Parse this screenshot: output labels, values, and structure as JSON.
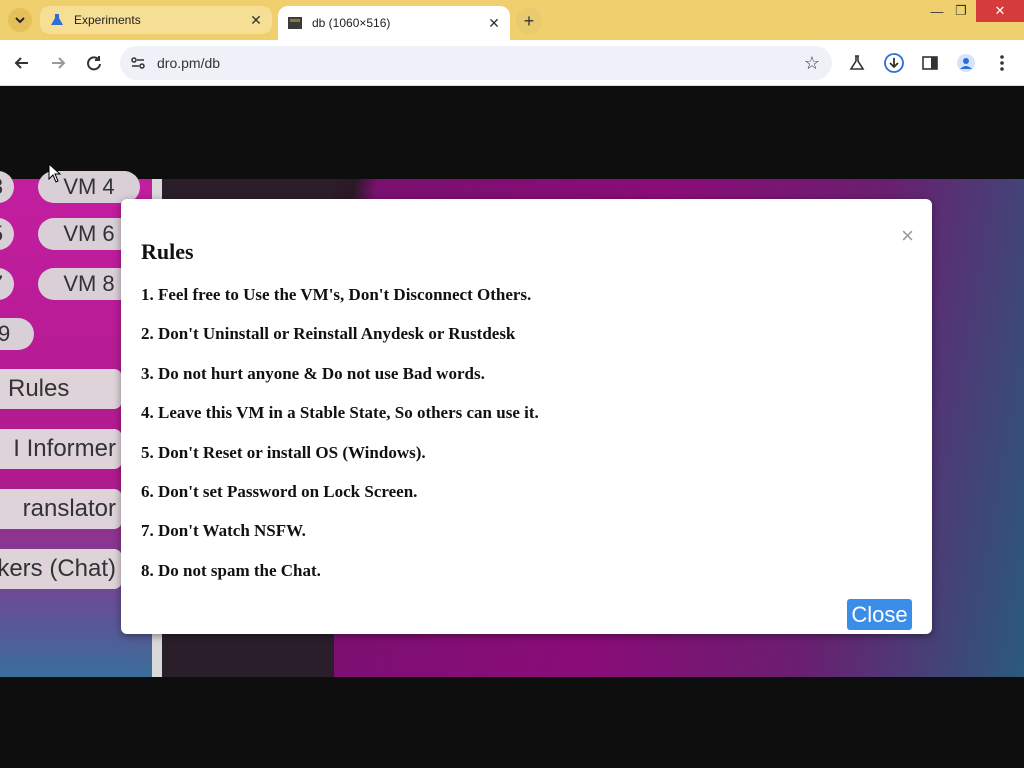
{
  "browser": {
    "tabs": [
      {
        "title": "Experiments",
        "active": false
      },
      {
        "title": "db (1060×516)",
        "active": true
      }
    ],
    "url": "dro.pm/db"
  },
  "sidebar": {
    "vm_pills": [
      {
        "label": "3"
      },
      {
        "label": "VM 4"
      },
      {
        "label": "5"
      },
      {
        "label": "VM 6"
      },
      {
        "label": "7"
      },
      {
        "label": "VM 8"
      },
      {
        "label": "9"
      }
    ],
    "buttons": [
      {
        "label": "Rules"
      },
      {
        "label": "I Informer"
      },
      {
        "label": "ranslator"
      },
      {
        "label": "kers (Chat)"
      }
    ]
  },
  "modal": {
    "title": "Rules",
    "close_x": "×",
    "rules": [
      "1. Feel free to Use the VM's, Don't Disconnect Others.",
      "2. Don't Uninstall or Reinstall Anydesk or Rustdesk",
      "3. Do not hurt anyone & Do not use Bad words.",
      "4. Leave this VM in a Stable State, So others can use it.",
      "5. Don't Reset or install OS (Windows).",
      "6. Don't set Password on Lock Screen.",
      "7. Don't Watch NSFW.",
      "8. Do not spam the Chat."
    ],
    "close_button": "Close"
  }
}
